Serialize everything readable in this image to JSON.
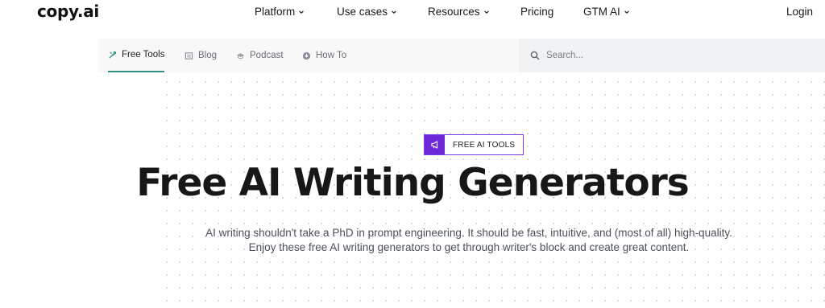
{
  "header": {
    "logo": "copy.ai",
    "nav": [
      {
        "label": "Platform"
      },
      {
        "label": "Use cases"
      },
      {
        "label": "Resources"
      },
      {
        "label": "Pricing"
      },
      {
        "label": "GTM AI"
      }
    ],
    "login": "Login"
  },
  "subnav": {
    "tabs": [
      {
        "label": "Free Tools",
        "icon": "tools-icon",
        "active": true
      },
      {
        "label": "Blog",
        "icon": "blog-icon"
      },
      {
        "label": "Podcast",
        "icon": "podcast-icon"
      },
      {
        "label": "How To",
        "icon": "howto-icon"
      }
    ],
    "search_placeholder": "Search..."
  },
  "hero": {
    "badge_label": "FREE AI TOOLS",
    "badge_icon": "megaphone-icon",
    "title": "Free AI Writing Generators",
    "subtitle_line1": "AI writing shouldn't take a PhD in prompt engineering. It should be fast, intuitive, and (most of all) high-quality.",
    "subtitle_line2": "Enjoy these free AI writing generators to get through writer's block and create great content."
  },
  "colors": {
    "accent_tab": "#2e8f7f",
    "badge_purple": "#6d28d9",
    "title": "#171717"
  }
}
